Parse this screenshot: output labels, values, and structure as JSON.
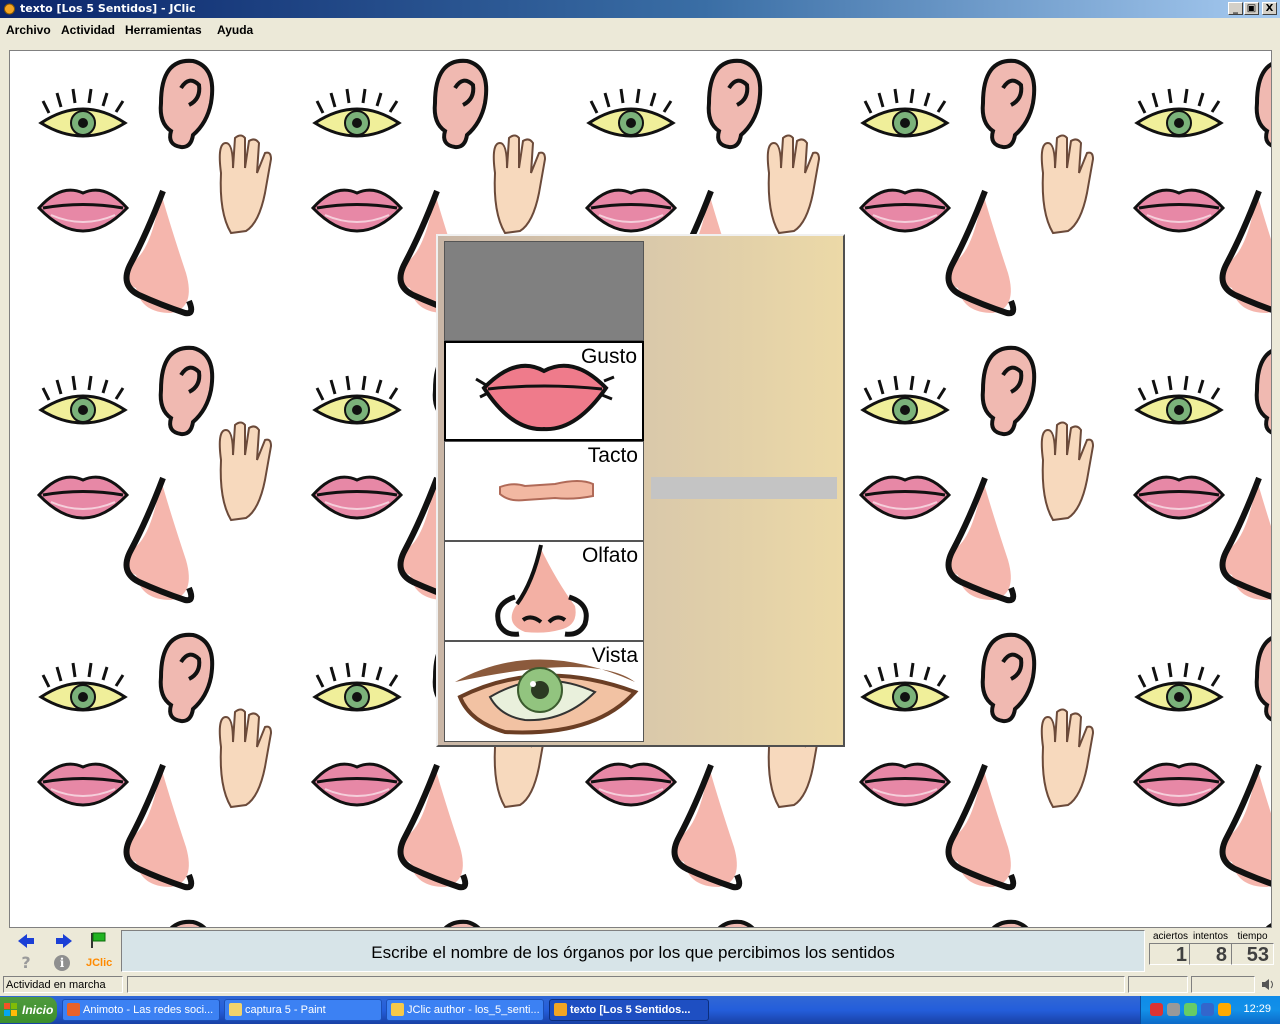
{
  "window": {
    "title": "texto [Los 5 Sentidos] - JClic",
    "min_label": "_",
    "max_label": "▣",
    "close_label": "X"
  },
  "menu": [
    {
      "label": "Archivo"
    },
    {
      "label": "Actividad"
    },
    {
      "label": "Herramientas"
    },
    {
      "label": "Ayuda"
    }
  ],
  "activity": {
    "cells": [
      {
        "label": "Gusto",
        "icon": "lips-icon",
        "selected": true
      },
      {
        "label": "Tacto",
        "icon": "arm-icon",
        "selected": false
      },
      {
        "label": "Olfato",
        "icon": "nose-icon",
        "selected": false
      },
      {
        "label": "Vista",
        "icon": "eye-icon",
        "selected": false
      }
    ],
    "answer_value": ""
  },
  "controls": {
    "prev_icon": "arrow-left-icon",
    "next_icon": "arrow-right-icon",
    "reset_icon": "flag-icon",
    "help_label": "?",
    "info_label": "i",
    "logo_label": "JClic",
    "message": "Escribe el nombre de los órganos por los que percibimos los sentidos"
  },
  "counters": {
    "aciertos_label": "aciertos",
    "aciertos": "1",
    "intentos_label": "intentos",
    "intentos": "8",
    "tiempo_label": "tiempo",
    "tiempo": "53"
  },
  "status": {
    "text": "Actividad en marcha"
  },
  "taskbar": {
    "start_label": "Inicio",
    "tasks": [
      {
        "label": "Animoto - Las redes soci..."
      },
      {
        "label": "captura 5 - Paint"
      },
      {
        "label": "JClic author - los_5_senti..."
      },
      {
        "label": "texto [Los 5 Sentidos..."
      }
    ],
    "clock": "12:29"
  },
  "colors": {
    "accent": "#0a246a",
    "message_bg": "#d7e4e8",
    "panel_left": "#c9b6a6",
    "panel_right": "#ecd9a7",
    "lips": "#e8788a",
    "skin": "#f3b9a8"
  }
}
